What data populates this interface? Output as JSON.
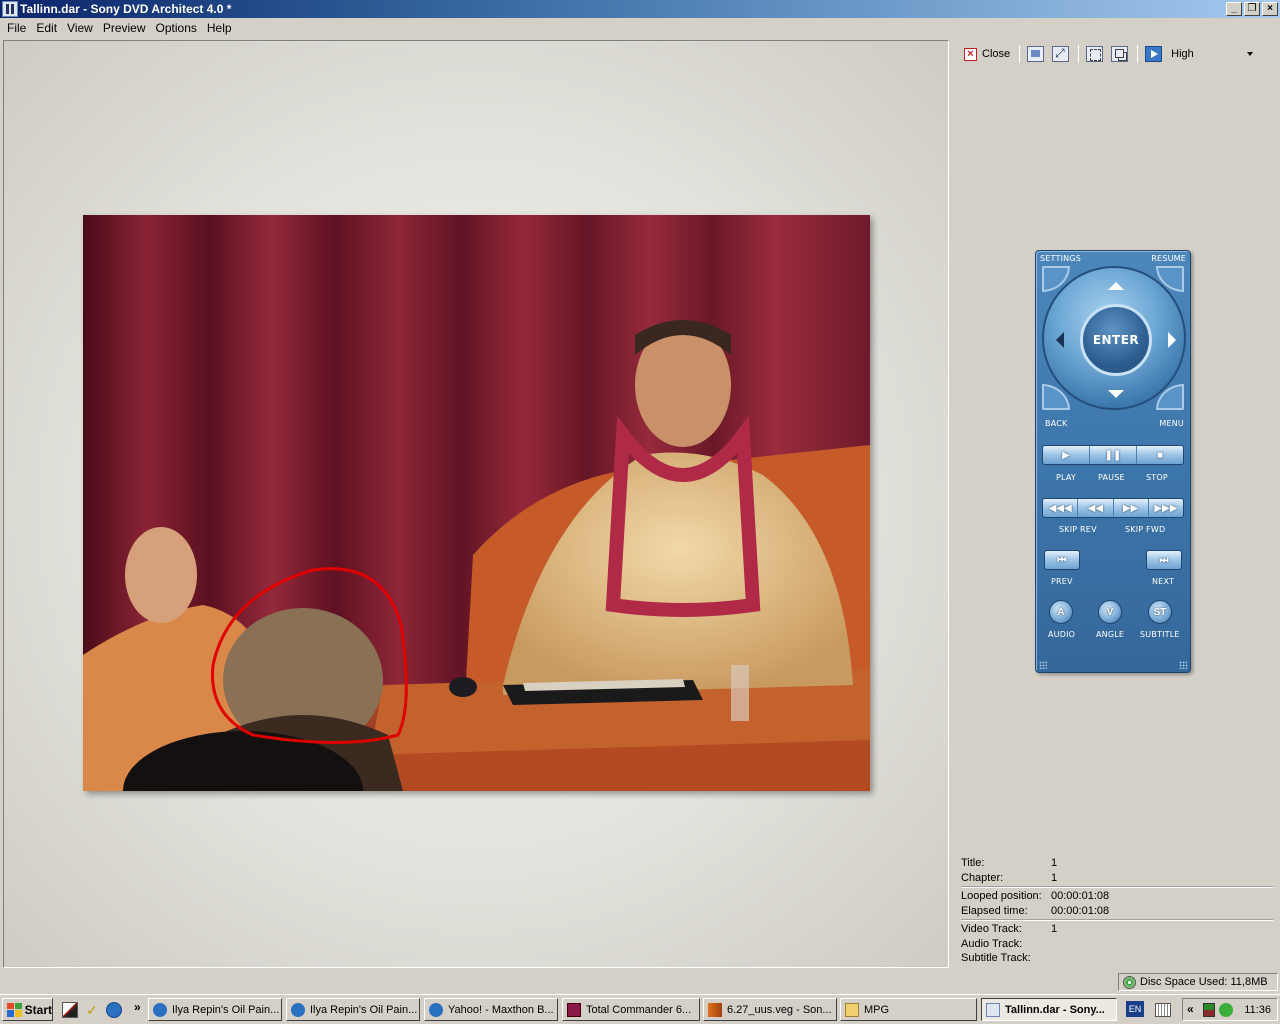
{
  "window": {
    "title": "Tallinn.dar - Sony DVD Architect 4.0 *"
  },
  "menu": [
    "File",
    "Edit",
    "View",
    "Preview",
    "Options",
    "Help"
  ],
  "toolbar": {
    "close_label": "Close",
    "quality_value": "High"
  },
  "remote": {
    "settings": "SETTINGS",
    "resume": "RESUME",
    "enter": "ENTER",
    "back": "BACK",
    "menu": "MENU",
    "play": "PLAY",
    "pause": "PAUSE",
    "stop": "STOP",
    "skip_rev": "SKIP REV",
    "skip_fwd": "SKIP FWD",
    "prev": "PREV",
    "next": "NEXT",
    "audio": "AUDIO",
    "angle": "ANGLE",
    "subtitle": "SUBTITLE",
    "audio_glyph": "A",
    "angle_glyph": "V",
    "subtitle_glyph": "ST"
  },
  "info": {
    "title_k": "Title:",
    "title_v": "1",
    "chapter_k": "Chapter:",
    "chapter_v": "1",
    "looped_k": "Looped position:",
    "looped_v": "00:00:01:08",
    "elapsed_k": "Elapsed time:",
    "elapsed_v": "00:00:01:08",
    "video_k": "Video Track:",
    "video_v": "1",
    "audio_k": "Audio Track:",
    "audio_v": "",
    "subtitle_k": "Subtitle Track:",
    "subtitle_v": ""
  },
  "status": {
    "disc_space": "Disc Space Used: 11,8MB"
  },
  "taskbar": {
    "start": "Start",
    "overflow": "»",
    "tasks": [
      "Ilya Repin's Oil Pain...",
      "Ilya Repin's Oil Pain...",
      "Yahoo! - Maxthon B...",
      "Total Commander 6...",
      "6.27_uus.veg - Son...",
      "MPG",
      "Tallinn.dar - Sony..."
    ],
    "lang": "EN",
    "tray_arrow": "«",
    "clock": "11:36"
  }
}
